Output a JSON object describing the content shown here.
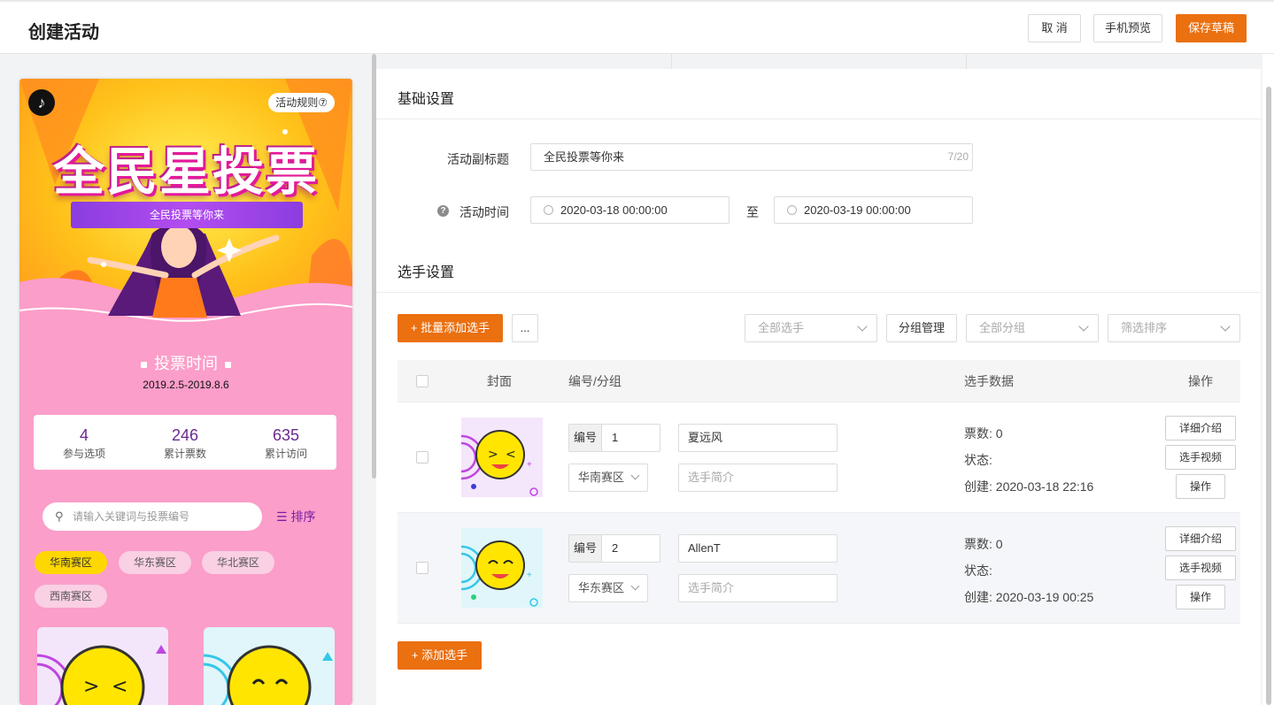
{
  "header": {
    "title": "创建活动",
    "cancel_label": "取 消",
    "preview_label": "手机预览",
    "save_label": "保存草稿"
  },
  "colors": {
    "accent": "#ea7010",
    "phone_bg": "#fb9ec9",
    "tag_active": "#ffd700"
  },
  "phone": {
    "rules_label": "活动规则⑦",
    "banner_title": "全民星投票",
    "banner_subtitle": "全民投票等你来",
    "vote_time_title": "投票时间",
    "vote_time_range": "2019.2.5-2019.8.6",
    "stats": [
      {
        "value": "4",
        "label": "参与选项"
      },
      {
        "value": "246",
        "label": "累计票数"
      },
      {
        "value": "635",
        "label": "累计访问"
      }
    ],
    "search_placeholder": "请输入关键词与投票编号",
    "sort_label": "排序",
    "tags": [
      "华南赛区",
      "华东赛区",
      "华北赛区",
      "西南赛区"
    ],
    "active_tag": "华南赛区"
  },
  "basic": {
    "section_title": "基础设置",
    "subtitle_label": "活动副标题",
    "subtitle_value": "全民投票等你来",
    "subtitle_count": "7/20",
    "time_label": "活动时间",
    "time_start": "2020-03-18 00:00:00",
    "time_sep": "至",
    "time_end": "2020-03-19 00:00:00"
  },
  "players": {
    "section_title": "选手设置",
    "bulk_add_label": "+ 批量添加选手",
    "more_label": "...",
    "filter_all_players": "全部选手",
    "group_manage_label": "分组管理",
    "filter_all_groups": "全部分组",
    "filter_sort": "筛选排序",
    "columns": {
      "cover": "封面",
      "number_group": "编号/分组",
      "data": "选手数据",
      "action": "操作"
    },
    "number_label": "编号",
    "intro_placeholder": "选手简介",
    "rows": [
      {
        "number": "1",
        "name": "夏远风",
        "group": "华南赛区",
        "votes": "票数: 0",
        "status": "状态:",
        "created": "创建: 2020-03-18 22:16",
        "btn_detail": "详细介绍",
        "btn_video": "选手视频",
        "btn_action": "操作"
      },
      {
        "number": "2",
        "name": "AllenT",
        "group": "华东赛区",
        "votes": "票数: 0",
        "status": "状态:",
        "created": "创建: 2020-03-19 00:25",
        "btn_detail": "详细介绍",
        "btn_video": "选手视频",
        "btn_action": "操作"
      }
    ],
    "add_label": "+ 添加选手"
  }
}
